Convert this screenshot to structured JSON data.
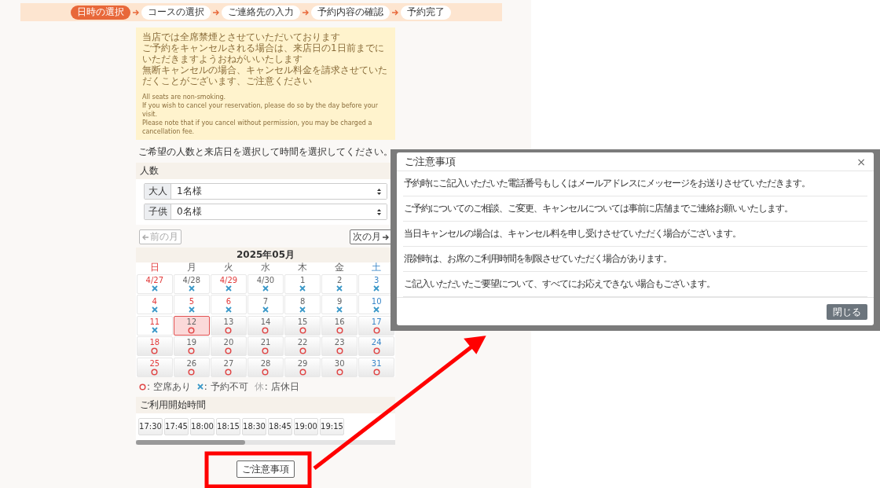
{
  "steps": [
    {
      "label": "日時の選択",
      "selected": true
    },
    {
      "label": "コースの選択",
      "selected": false
    },
    {
      "label": "ご連絡先の入力",
      "selected": false
    },
    {
      "label": "予約内容の確認",
      "selected": false
    },
    {
      "label": "予約完了",
      "selected": false
    }
  ],
  "notice": {
    "paragraphs": [
      "当店では全席禁煙とさせていただいております",
      "ご予約をキャンセルされる場合は、来店日の1日前までにいただきますようおねがいいたします",
      "無断キャンセルの場合、キャンセル料金を請求させていただくことがございます、ご注意ください"
    ],
    "paragraphs_en": [
      "All seats are non-smoking.",
      "If you wish to cancel your reservation, please do so by the day before your visit.",
      "Please note that if you cancel without permission, you may be charged a cancellation fee."
    ]
  },
  "instruction": "ご希望の人数と来店日を選択して時間を選択してください。",
  "party": {
    "title": "人数",
    "selects": [
      {
        "label": "大人",
        "value": "1名様"
      },
      {
        "label": "子供",
        "value": "0名様"
      }
    ]
  },
  "month_nav": {
    "prev": {
      "label": "前の月",
      "disabled": true
    },
    "next": {
      "label": "次の月",
      "disabled": false
    }
  },
  "calendar": {
    "month": "2025年05月",
    "weekdays": [
      {
        "label": "日",
        "kind": "holiday"
      },
      {
        "label": "月",
        "kind": "weekday"
      },
      {
        "label": "火",
        "kind": "weekday"
      },
      {
        "label": "水",
        "kind": "weekday"
      },
      {
        "label": "木",
        "kind": "weekday"
      },
      {
        "label": "金",
        "kind": "weekday"
      },
      {
        "label": "土",
        "kind": "saturday"
      }
    ],
    "weeks": [
      [
        {
          "label": "4/27",
          "kind": "holiday",
          "available": false,
          "selected": false
        },
        {
          "label": "4/28",
          "kind": "weekday",
          "available": false,
          "selected": false
        },
        {
          "label": "4/29",
          "kind": "holiday",
          "available": false,
          "selected": false
        },
        {
          "label": "4/30",
          "kind": "weekday",
          "available": false,
          "selected": false
        },
        {
          "label": "1",
          "kind": "weekday",
          "available": false,
          "selected": false
        },
        {
          "label": "2",
          "kind": "weekday",
          "available": false,
          "selected": false
        },
        {
          "label": "3",
          "kind": "saturday",
          "available": false,
          "selected": false
        }
      ],
      [
        {
          "label": "4",
          "kind": "holiday",
          "available": false,
          "selected": false
        },
        {
          "label": "5",
          "kind": "holiday",
          "available": false,
          "selected": false
        },
        {
          "label": "6",
          "kind": "holiday",
          "available": false,
          "selected": false
        },
        {
          "label": "7",
          "kind": "weekday",
          "available": false,
          "selected": false
        },
        {
          "label": "8",
          "kind": "weekday",
          "available": false,
          "selected": false
        },
        {
          "label": "9",
          "kind": "weekday",
          "available": false,
          "selected": false
        },
        {
          "label": "10",
          "kind": "saturday",
          "available": false,
          "selected": false
        }
      ],
      [
        {
          "label": "11",
          "kind": "holiday",
          "available": false,
          "selected": false
        },
        {
          "label": "12",
          "kind": "weekday",
          "available": true,
          "selected": true
        },
        {
          "label": "13",
          "kind": "weekday",
          "available": true,
          "selected": false
        },
        {
          "label": "14",
          "kind": "weekday",
          "available": true,
          "selected": false
        },
        {
          "label": "15",
          "kind": "weekday",
          "available": true,
          "selected": false
        },
        {
          "label": "16",
          "kind": "weekday",
          "available": true,
          "selected": false
        },
        {
          "label": "17",
          "kind": "saturday",
          "available": true,
          "selected": false
        }
      ],
      [
        {
          "label": "18",
          "kind": "holiday",
          "available": true,
          "selected": false
        },
        {
          "label": "19",
          "kind": "weekday",
          "available": true,
          "selected": false
        },
        {
          "label": "20",
          "kind": "weekday",
          "available": true,
          "selected": false
        },
        {
          "label": "21",
          "kind": "weekday",
          "available": true,
          "selected": false
        },
        {
          "label": "22",
          "kind": "weekday",
          "available": true,
          "selected": false
        },
        {
          "label": "23",
          "kind": "weekday",
          "available": true,
          "selected": false
        },
        {
          "label": "24",
          "kind": "saturday",
          "available": true,
          "selected": false
        }
      ],
      [
        {
          "label": "25",
          "kind": "holiday",
          "available": true,
          "selected": false
        },
        {
          "label": "26",
          "kind": "weekday",
          "available": true,
          "selected": false
        },
        {
          "label": "27",
          "kind": "weekday",
          "available": true,
          "selected": false
        },
        {
          "label": "28",
          "kind": "weekday",
          "available": true,
          "selected": false
        },
        {
          "label": "29",
          "kind": "weekday",
          "available": true,
          "selected": false
        },
        {
          "label": "30",
          "kind": "weekday",
          "available": true,
          "selected": false
        },
        {
          "label": "31",
          "kind": "saturday",
          "available": true,
          "selected": false
        }
      ]
    ],
    "legend": [
      {
        "kind": "open",
        "text": ": 空席あり"
      },
      {
        "kind": "full",
        "text": ": 予約不可"
      },
      {
        "kind": "closed",
        "symbol": "休",
        "text": ": 店休日"
      }
    ]
  },
  "times": {
    "title": "ご利用開始時間",
    "slots": [
      "17:30",
      "17:45",
      "18:00",
      "18:15",
      "18:30",
      "18:45",
      "19:00",
      "19:15"
    ]
  },
  "notes_button": "ご注意事項",
  "modal": {
    "title": "ご注意事項",
    "close": "×",
    "items": [
      "予約時にご記入いただいた電話番号もしくはメールアドレスにメッセージをお送りさせていただきます。",
      "ご予約についてのご相談、ご変更、キャンセルについては事前に店舗までご連絡お願いいたします。",
      "当日キャンセルの場合は、キャンセル料を申し受けさせていただく場合がございます。",
      "混雑時は、お席のご利用時間を制限させていただく場合があります。",
      "ご記入いただいたご要望について、すべてにお応えできない場合もございます。"
    ],
    "button": "閉じる"
  }
}
